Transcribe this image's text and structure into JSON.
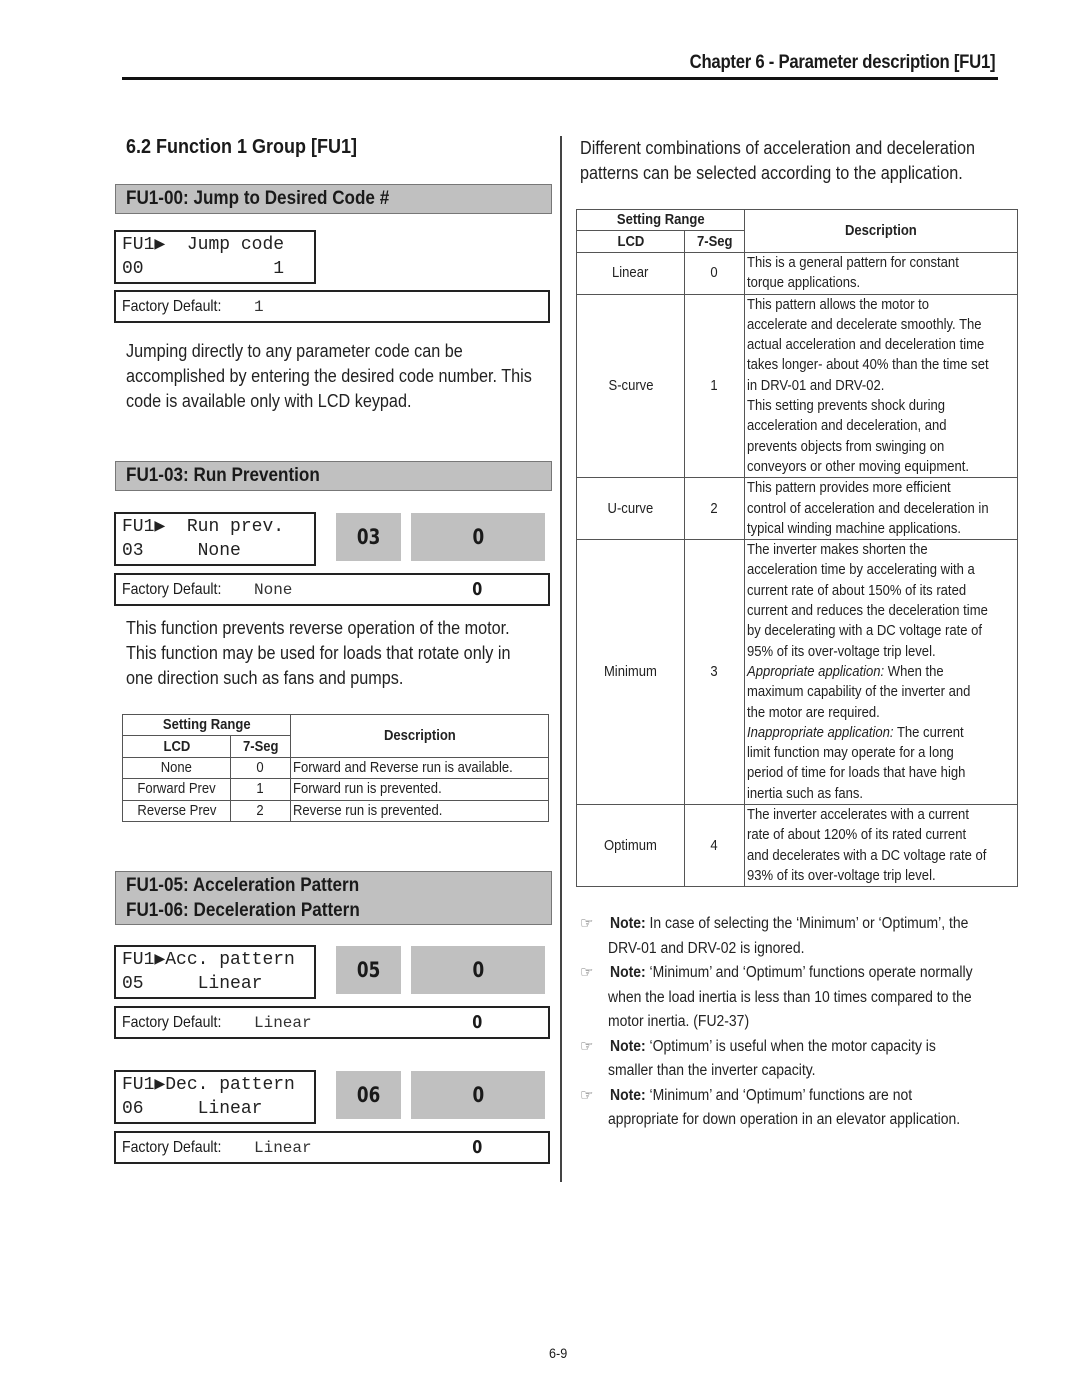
{
  "header": {
    "chapter_title": "Chapter 6 - Parameter description [FU1]"
  },
  "section": {
    "title": "6.2  Function 1 Group [FU1]"
  },
  "params": {
    "fu1_00": {
      "title": "FU1-00: Jump to Desired Code #",
      "lcd_line1": "FU1▶  Jump code",
      "lcd_line2": "00            1",
      "factory_label": "Factory Default:",
      "factory_value": "1",
      "description": "Jumping directly to any parameter code can be accomplished by entering the desired code number. This code is available only with LCD keypad."
    },
    "fu1_03": {
      "title": "FU1-03: Run Prevention",
      "lcd_line1": "FU1▶  Run prev.",
      "lcd_line2": "03     None",
      "seg_code": "03",
      "seg_value": "0",
      "factory_label": "Factory Default:",
      "factory_value": "None",
      "factory_seg": "0",
      "description": "This function prevents reverse operation of the motor. This function may be used for loads that rotate only in one direction such as fans and pumps.",
      "table": {
        "header_setting_range": "Setting Range",
        "header_lcd": "LCD",
        "header_seg": "7-Seg",
        "header_description": "Description",
        "rows": [
          {
            "lcd": "None",
            "seg": "0",
            "desc": "Forward and Reverse run is available."
          },
          {
            "lcd": "Forward Prev",
            "seg": "1",
            "desc": "Forward run is prevented."
          },
          {
            "lcd": "Reverse Prev",
            "seg": "2",
            "desc": "Reverse run is prevented."
          }
        ]
      }
    },
    "fu1_05_06": {
      "title_line1": "FU1-05: Acceleration Pattern",
      "title_line2": "FU1-06: Deceleration Pattern",
      "acc": {
        "lcd_line1": "FU1▶Acc. pattern",
        "lcd_line2": "05     Linear",
        "seg_code": "05",
        "seg_value": "0",
        "factory_label": "Factory Default:",
        "factory_value": "Linear",
        "factory_seg": "0"
      },
      "dec": {
        "lcd_line1": "FU1▶Dec. pattern",
        "lcd_line2": "06     Linear",
        "seg_code": "06",
        "seg_value": "0",
        "factory_label": "Factory Default:",
        "factory_value": "Linear",
        "factory_seg": "0"
      },
      "intro": "Different combinations of acceleration and deceleration patterns can be selected according to the application.",
      "table": {
        "header_setting_range": "Setting Range",
        "header_lcd": "LCD",
        "header_seg": "7-Seg",
        "header_description": "Description",
        "rows": [
          {
            "lcd": "Linear",
            "seg": "0",
            "desc_lines": [
              "This is a general pattern for constant",
              "torque applications."
            ]
          },
          {
            "lcd": "S-curve",
            "seg": "1",
            "desc_lines": [
              "This pattern allows the motor to",
              "accelerate and decelerate smoothly. The",
              "actual acceleration and deceleration time",
              "takes longer- about 40% than the time set",
              "in DRV-01 and DRV-02.",
              "This setting prevents shock during",
              "acceleration and deceleration, and",
              "prevents objects from swinging on",
              "conveyors or other moving equipment."
            ]
          },
          {
            "lcd": "U-curve",
            "seg": "2",
            "desc_lines": [
              "This pattern provides more efficient",
              "control of acceleration and deceleration in",
              "typical winding machine applications."
            ]
          },
          {
            "lcd": "Minimum",
            "seg": "3",
            "desc_lines": [
              "The inverter makes shorten the",
              "acceleration time by accelerating with a",
              "current rate of about 150% of its rated",
              "current and reduces the deceleration time",
              "by decelerating with a DC voltage rate of",
              "95% of its over-voltage trip level."
            ],
            "appropriate_label": "Appropriate application:",
            "appropriate_lines": [
              " When the",
              "maximum capability of the inverter and",
              "the motor are required."
            ],
            "inappropriate_label": "Inappropriate application:",
            "inappropriate_lines": [
              " The current",
              "limit function may operate for a long",
              "period of time for loads that have high",
              "inertia such as fans."
            ]
          },
          {
            "lcd": "Optimum",
            "seg": "4",
            "desc_lines": [
              "The inverter accelerates with a current",
              "rate of about 120% of its rated current",
              "and decelerates with a DC voltage rate of",
              "93% of its over-voltage trip level."
            ]
          }
        ]
      },
      "notes": [
        {
          "icon": "pointing-hand-icon",
          "label": "Note:",
          "line1": " In case of selecting the ‘Minimum’ or ‘Optimum’, the",
          "rest": [
            "DRV-01 and DRV-02 is ignored."
          ]
        },
        {
          "icon": "pointing-hand-icon",
          "label": "Note:",
          "line1": " ‘Minimum’ and ‘Optimum’ functions operate normally",
          "rest": [
            "when the load inertia is less than 10 times compared to the",
            "motor inertia. (FU2-37)"
          ]
        },
        {
          "icon": "pointing-hand-icon",
          "label": "Note:",
          "line1": " ‘Optimum’ is useful when the motor capacity is",
          "rest": [
            "smaller than the inverter capacity."
          ]
        },
        {
          "icon": "pointing-hand-icon",
          "label": "Note:",
          "line1": " ‘Minimum’ and ‘Optimum’ functions are not",
          "rest": [
            "appropriate for down operation in an elevator application."
          ]
        }
      ]
    }
  },
  "footer": {
    "page_number": "6-9"
  }
}
